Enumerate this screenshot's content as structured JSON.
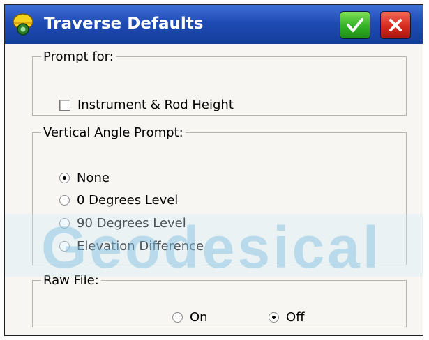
{
  "window": {
    "title": "Traverse Defaults",
    "ok_icon": "checkmark-icon",
    "close_icon": "close-x-icon"
  },
  "prompt_for": {
    "legend": "Prompt for:",
    "checkbox_label": "Instrument & Rod Height",
    "checked": false
  },
  "vertical_angle": {
    "legend": "Vertical Angle Prompt:",
    "options": [
      "None",
      "0 Degrees Level",
      "90 Degrees Level",
      "Elevation Difference"
    ],
    "selected": "None"
  },
  "raw_file": {
    "legend": "Raw File:",
    "options": [
      "On",
      "Off"
    ],
    "selected": "Off"
  },
  "watermark": {
    "text": "Geodesical"
  },
  "colors": {
    "titlebar": "#1f4bb4",
    "ok": "#33b125",
    "close": "#d62b1f",
    "watermark": "#7fbfe0"
  }
}
